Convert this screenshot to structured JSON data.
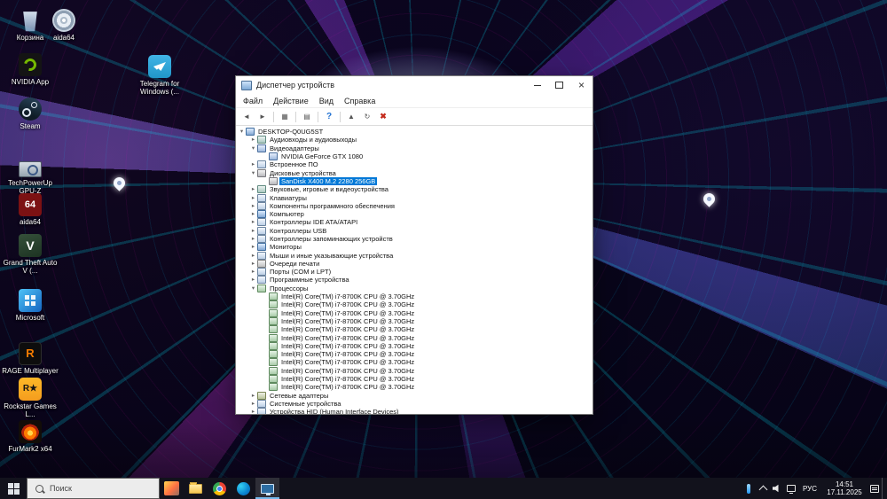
{
  "colors": {
    "selection_blue": "#0078d7",
    "taskbar_underline": "#76b9ed",
    "nvidia_green": "#76b900"
  },
  "desktop": {
    "icons": [
      {
        "name": "recycle-bin",
        "label": "Корзина"
      },
      {
        "name": "aida64-portable",
        "label": "aida64"
      },
      {
        "name": "nvidia-app",
        "label": "NVIDIA App"
      },
      {
        "name": "telegram",
        "label": "Telegram for Windows (..."
      },
      {
        "name": "steam",
        "label": "Steam"
      },
      {
        "name": "gpu-z",
        "label": "TechPowerUp GPU-Z"
      },
      {
        "name": "aida64",
        "label": "aida64"
      },
      {
        "name": "gta-v",
        "label": "Grand Theft Auto V (..."
      },
      {
        "name": "microsoft",
        "label": "Microsoft"
      },
      {
        "name": "rage-multiplayer",
        "label": "RAGE Multiplayer"
      },
      {
        "name": "rockstar-games",
        "label": "Rockstar Games L..."
      },
      {
        "name": "furmark2",
        "label": "FurMark2 x64"
      }
    ]
  },
  "window": {
    "title": "Диспетчер устройств",
    "menu": [
      "Файл",
      "Действие",
      "Вид",
      "Справка"
    ],
    "toolbar": [
      {
        "name": "back",
        "glyph": "◄"
      },
      {
        "name": "forward",
        "glyph": "►"
      },
      {
        "name": "show-console-tree",
        "glyph": "▦"
      },
      {
        "name": "properties",
        "glyph": "▤"
      },
      {
        "name": "help",
        "glyph": "?"
      },
      {
        "name": "update-driver-software",
        "glyph": "▲"
      },
      {
        "name": "scan-for-hardware-changes",
        "glyph": "↻"
      },
      {
        "name": "uninstall-device",
        "glyph": "✖"
      }
    ],
    "tree": [
      {
        "label": "DESKTOP-Q0UG5ST",
        "level": 0,
        "state": "expanded",
        "icon": "computer-icon"
      },
      {
        "label": "Аудиовходы и аудиовыходы",
        "level": 1,
        "state": "collapsed",
        "icon": "audio-endpoint-icon"
      },
      {
        "label": "Видеоадаптеры",
        "level": 1,
        "state": "expanded",
        "icon": "display-adapter-icon"
      },
      {
        "label": "NVIDIA GeForce GTX 1080",
        "level": 2,
        "state": "leaf",
        "icon": "display-adapter-icon"
      },
      {
        "label": "Встроенное ПО",
        "level": 1,
        "state": "collapsed",
        "icon": "firmware-icon"
      },
      {
        "label": "Дисковые устройства",
        "level": 1,
        "state": "expanded",
        "icon": "disk-drive-icon"
      },
      {
        "label": "SanDisk X400 M.2 2280 256GB",
        "level": 2,
        "state": "leaf",
        "icon": "disk-drive-icon",
        "selected": true
      },
      {
        "label": "Звуковые, игровые и видеоустройства",
        "level": 1,
        "state": "collapsed",
        "icon": "sound-icon"
      },
      {
        "label": "Клавиатуры",
        "level": 1,
        "state": "collapsed",
        "icon": "keyboard-icon"
      },
      {
        "label": "Компоненты программного обеспечения",
        "level": 1,
        "state": "collapsed",
        "icon": "software-component-icon"
      },
      {
        "label": "Компьютер",
        "level": 1,
        "state": "collapsed",
        "icon": "computer-icon"
      },
      {
        "label": "Контроллеры IDE ATA/ATAPI",
        "level": 1,
        "state": "collapsed",
        "icon": "ide-controller-icon"
      },
      {
        "label": "Контроллеры USB",
        "level": 1,
        "state": "collapsed",
        "icon": "usb-controller-icon"
      },
      {
        "label": "Контроллеры запоминающих устройств",
        "level": 1,
        "state": "collapsed",
        "icon": "storage-controller-icon"
      },
      {
        "label": "Мониторы",
        "level": 1,
        "state": "collapsed",
        "icon": "monitor-icon"
      },
      {
        "label": "Мыши и иные указывающие устройства",
        "level": 1,
        "state": "collapsed",
        "icon": "mouse-icon"
      },
      {
        "label": "Очереди печати",
        "level": 1,
        "state": "collapsed",
        "icon": "print-queue-icon"
      },
      {
        "label": "Порты (COM и LPT)",
        "level": 1,
        "state": "collapsed",
        "icon": "ports-icon"
      },
      {
        "label": "Программные устройства",
        "level": 1,
        "state": "collapsed",
        "icon": "software-device-icon"
      },
      {
        "label": "Процессоры",
        "level": 1,
        "state": "expanded",
        "icon": "cpu-icon"
      },
      {
        "label": "Intel(R) Core(TM) i7-8700K CPU @ 3.70GHz",
        "level": 2,
        "state": "leaf",
        "icon": "cpu-icon"
      },
      {
        "label": "Intel(R) Core(TM) i7-8700K CPU @ 3.70GHz",
        "level": 2,
        "state": "leaf",
        "icon": "cpu-icon"
      },
      {
        "label": "Intel(R) Core(TM) i7-8700K CPU @ 3.70GHz",
        "level": 2,
        "state": "leaf",
        "icon": "cpu-icon"
      },
      {
        "label": "Intel(R) Core(TM) i7-8700K CPU @ 3.70GHz",
        "level": 2,
        "state": "leaf",
        "icon": "cpu-icon"
      },
      {
        "label": "Intel(R) Core(TM) i7-8700K CPU @ 3.70GHz",
        "level": 2,
        "state": "leaf",
        "icon": "cpu-icon"
      },
      {
        "label": "Intel(R) Core(TM) i7-8700K CPU @ 3.70GHz",
        "level": 2,
        "state": "leaf",
        "icon": "cpu-icon"
      },
      {
        "label": "Intel(R) Core(TM) i7-8700K CPU @ 3.70GHz",
        "level": 2,
        "state": "leaf",
        "icon": "cpu-icon"
      },
      {
        "label": "Intel(R) Core(TM) i7-8700K CPU @ 3.70GHz",
        "level": 2,
        "state": "leaf",
        "icon": "cpu-icon"
      },
      {
        "label": "Intel(R) Core(TM) i7-8700K CPU @ 3.70GHz",
        "level": 2,
        "state": "leaf",
        "icon": "cpu-icon"
      },
      {
        "label": "Intel(R) Core(TM) i7-8700K CPU @ 3.70GHz",
        "level": 2,
        "state": "leaf",
        "icon": "cpu-icon"
      },
      {
        "label": "Intel(R) Core(TM) i7-8700K CPU @ 3.70GHz",
        "level": 2,
        "state": "leaf",
        "icon": "cpu-icon"
      },
      {
        "label": "Intel(R) Core(TM) i7-8700K CPU @ 3.70GHz",
        "level": 2,
        "state": "leaf",
        "icon": "cpu-icon"
      },
      {
        "label": "Сетевые адаптеры",
        "level": 1,
        "state": "collapsed",
        "icon": "network-adapter-icon"
      },
      {
        "label": "Системные устройства",
        "level": 1,
        "state": "collapsed",
        "icon": "system-device-icon"
      },
      {
        "label": "Устройства HID (Human Interface Devices)",
        "level": 1,
        "state": "collapsed",
        "icon": "hid-icon"
      }
    ]
  },
  "taskbar": {
    "search_placeholder": "Поиск",
    "apps": [
      {
        "name": "widgets",
        "active": false
      },
      {
        "name": "file-explorer",
        "active": false
      },
      {
        "name": "chrome",
        "active": false
      },
      {
        "name": "edge",
        "active": false
      },
      {
        "name": "device-manager",
        "active": true
      }
    ],
    "tray": {
      "language": "РУС",
      "time": "14:51",
      "date": "17.11.2025"
    }
  }
}
